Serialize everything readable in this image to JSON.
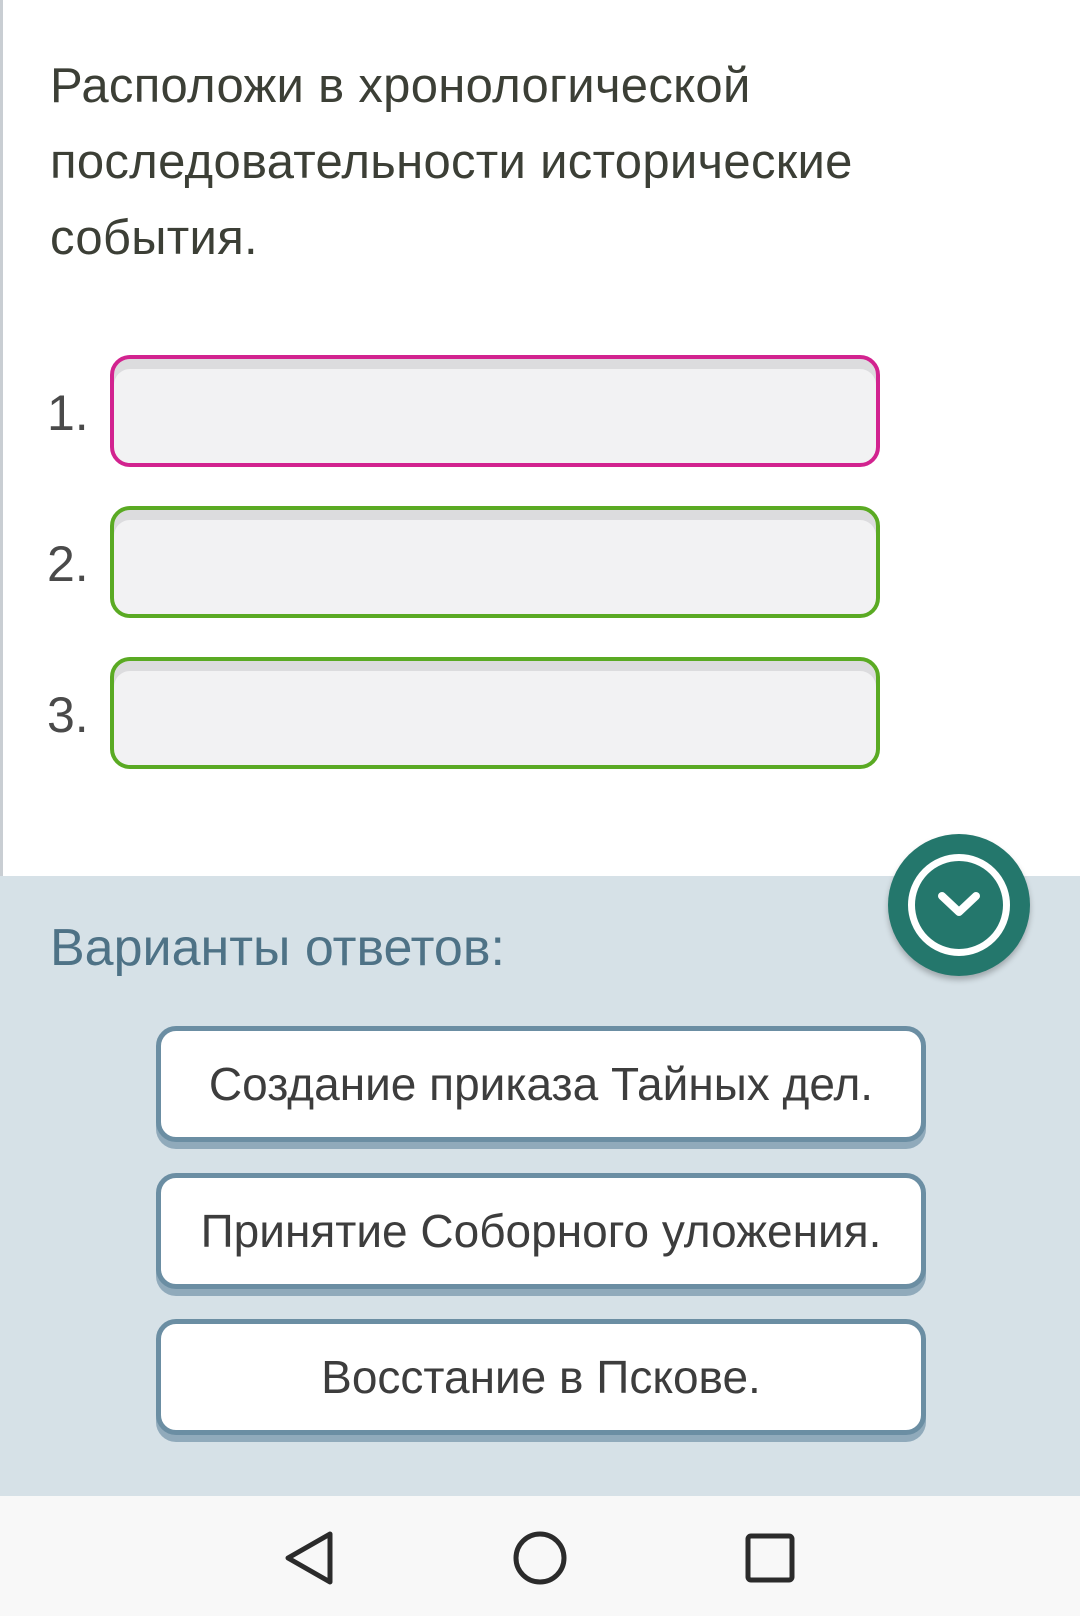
{
  "question": {
    "lines": [
      "Расположи в хронологической",
      "последовательности исторические",
      "события."
    ]
  },
  "answer_slots": [
    {
      "number": "1.",
      "value": "",
      "border_color": "#d2238f",
      "active": true
    },
    {
      "number": "2.",
      "value": "",
      "border_color": "#5aaa23",
      "active": false
    },
    {
      "number": "3.",
      "value": "",
      "border_color": "#5aaa23",
      "active": false
    }
  ],
  "options_panel": {
    "title": "Варианты ответов:",
    "collapse_icon": "chevron-down-in-circle",
    "items": [
      "Создание приказа Тайных дел.",
      "Принятие Соборного уложения.",
      "Восстание в Пскове."
    ]
  },
  "system_nav": {
    "buttons": [
      "back-triangle",
      "home-circle",
      "recents-square"
    ]
  },
  "colors": {
    "active_slot": "#d2238f",
    "filled_slot": "#5aaa23",
    "panel_bg": "#d6e1e7",
    "panel_title": "#4e7286",
    "collapse_button": "#24776c",
    "option_border": "#6b8ea3"
  }
}
